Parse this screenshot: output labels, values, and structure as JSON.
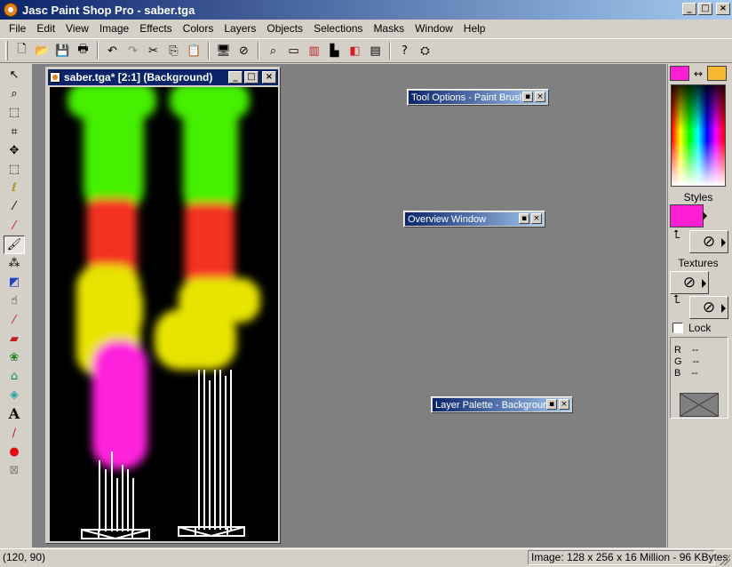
{
  "window": {
    "title": "Jasc Paint Shop Pro - saber.tga",
    "buttons": {
      "minimize": "_",
      "maximize": "□",
      "close": "×"
    }
  },
  "menu": [
    "File",
    "Edit",
    "View",
    "Image",
    "Effects",
    "Colors",
    "Layers",
    "Objects",
    "Selections",
    "Masks",
    "Window",
    "Help"
  ],
  "toolbar": {
    "icons": [
      "new-icon",
      "open-icon",
      "save-icon",
      "print-icon",
      "undo-icon",
      "redo-icon",
      "cut-icon",
      "copy-icon",
      "paste-icon",
      "full-screen-preview-icon",
      "overview-icon",
      "zoom-icon",
      "tool-options-icon",
      "color-palette-icon",
      "histogram-icon",
      "layers-icon",
      "overview-window-icon",
      "help-icon",
      "script-icon"
    ]
  },
  "tools": [
    "arrow-icon",
    "zoom-icon",
    "deform-icon",
    "crop-icon",
    "mover-icon",
    "selection-icon",
    "freehand-icon",
    "magic-wand-icon",
    "dropper-icon",
    "paint-brush-icon",
    "clone-brush-icon",
    "color-replacer-icon",
    "retouch-icon",
    "scratch-remover-icon",
    "eraser-icon",
    "picture-tube-icon",
    "airbrush-icon",
    "flood-fill-icon",
    "text-icon",
    "draw-icon",
    "preset-shapes-icon",
    "object-selector-icon"
  ],
  "active_tool_index": 9,
  "document": {
    "title": "saber.tga* [2:1] (Background)"
  },
  "palettes": {
    "tool_options": "Tool Options - Paint Brush",
    "overview": "Overview Window",
    "layer": "Layer Palette - Background"
  },
  "color_panel": {
    "foreground": "#ff1fd2",
    "background": "#f5b830",
    "styles_label": "Styles",
    "textures_label": "Textures",
    "lock_label": "Lock",
    "r_label": "R",
    "g_label": "G",
    "b_label": "B",
    "r_value": "--",
    "g_value": "--",
    "b_value": "--"
  },
  "status": {
    "coords": "(120, 90)",
    "image_info": "Image:  128 x 256 x 16 Million - 96 KBytes"
  },
  "colors": {
    "title_blue": "#0a246a",
    "workspace_gray": "#808080",
    "saber_green": "#44f000",
    "saber_red": "#f43020",
    "saber_yellow": "#e8e400",
    "saber_magenta": "#ff22dd"
  }
}
